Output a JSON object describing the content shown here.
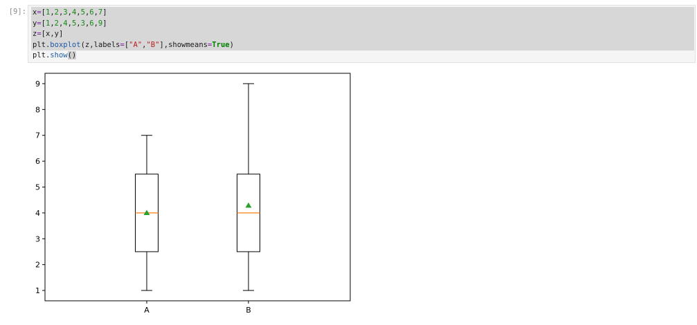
{
  "notebook": {
    "execution_count_label": "[9]:",
    "code": {
      "line1": [
        "x",
        "=",
        "[",
        "1",
        ",",
        "2",
        ",",
        "3",
        ",",
        "4",
        ",",
        "5",
        ",",
        "6",
        ",",
        "7",
        "]"
      ],
      "line2": [
        "y",
        "=",
        "[",
        "1",
        ",",
        "2",
        ",",
        "4",
        ",",
        "5",
        ",",
        "3",
        ",",
        "6",
        ",",
        "9",
        "]"
      ],
      "line3": [
        "z",
        "=",
        "[",
        "x",
        ",",
        "y",
        "]"
      ],
      "line4": {
        "obj": "plt",
        "dot": ".",
        "fn": "boxplot",
        "open": "(",
        "arg1": "z",
        "comma1": ",",
        "kw1": "labels",
        "eq1": "=",
        "lb": "[",
        "s1": "\"A\"",
        "comma2": ",",
        "s2": "\"B\"",
        "rb": "]",
        "comma3": ",",
        "kw2": "showmeans",
        "eq2": "=",
        "val2": "True",
        "close": ")"
      },
      "line5": {
        "obj": "plt",
        "dot": ".",
        "fn": "show",
        "call": "()"
      }
    }
  },
  "colors": {
    "box_edge": "#000000",
    "median": "#ff7f0e",
    "mean_marker": "#2ca02c",
    "code_bg": "#f5f5f5",
    "selection": "#d7d7d7"
  },
  "chart_data": {
    "type": "boxplot",
    "title": "",
    "xlabel": "",
    "ylabel": "",
    "categories": [
      "A",
      "B"
    ],
    "series": [
      {
        "name": "A",
        "values": [
          1,
          2,
          3,
          4,
          5,
          6,
          7
        ],
        "whisker_low": 1,
        "q1": 2.5,
        "median": 4,
        "q3": 5.5,
        "whisker_high": 7,
        "mean": 4.0
      },
      {
        "name": "B",
        "values": [
          1,
          2,
          4,
          5,
          3,
          6,
          9
        ],
        "whisker_low": 1,
        "q1": 2.5,
        "median": 4,
        "q3": 5.5,
        "whisker_high": 9,
        "mean": 4.2857
      }
    ],
    "yticks": [
      1,
      2,
      3,
      4,
      5,
      6,
      7,
      8,
      9
    ],
    "ylim": [
      0.6,
      9.4
    ],
    "grid": false,
    "legend": "none"
  }
}
